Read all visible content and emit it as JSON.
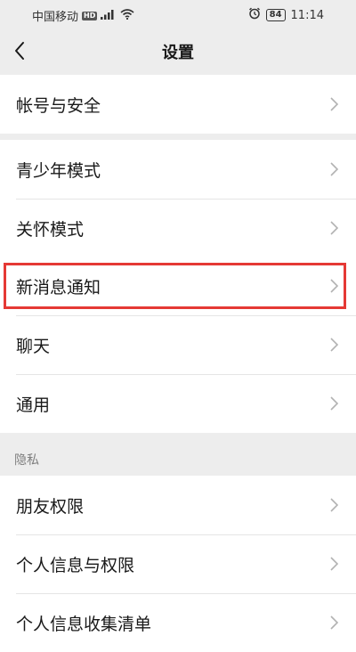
{
  "status_bar": {
    "carrier": "中国移动",
    "hd": "HD",
    "signal": "⁴ᴳ",
    "battery": "84",
    "time": "11:14"
  },
  "nav": {
    "title": "设置",
    "back_icon": "chevron-left-icon"
  },
  "sections": [
    {
      "items": [
        {
          "label": "帐号与安全"
        }
      ]
    },
    {
      "items": [
        {
          "label": "青少年模式"
        },
        {
          "label": "关怀模式"
        }
      ]
    },
    {
      "items": [
        {
          "label": "新消息通知"
        },
        {
          "label": "聊天"
        },
        {
          "label": "通用"
        }
      ]
    },
    {
      "header": "隐私",
      "items": [
        {
          "label": "朋友权限"
        },
        {
          "label": "个人信息与权限"
        },
        {
          "label": "个人信息收集清单"
        }
      ]
    }
  ],
  "colors": {
    "background": "#ededed",
    "card": "#ffffff",
    "highlight": "#e53935"
  }
}
